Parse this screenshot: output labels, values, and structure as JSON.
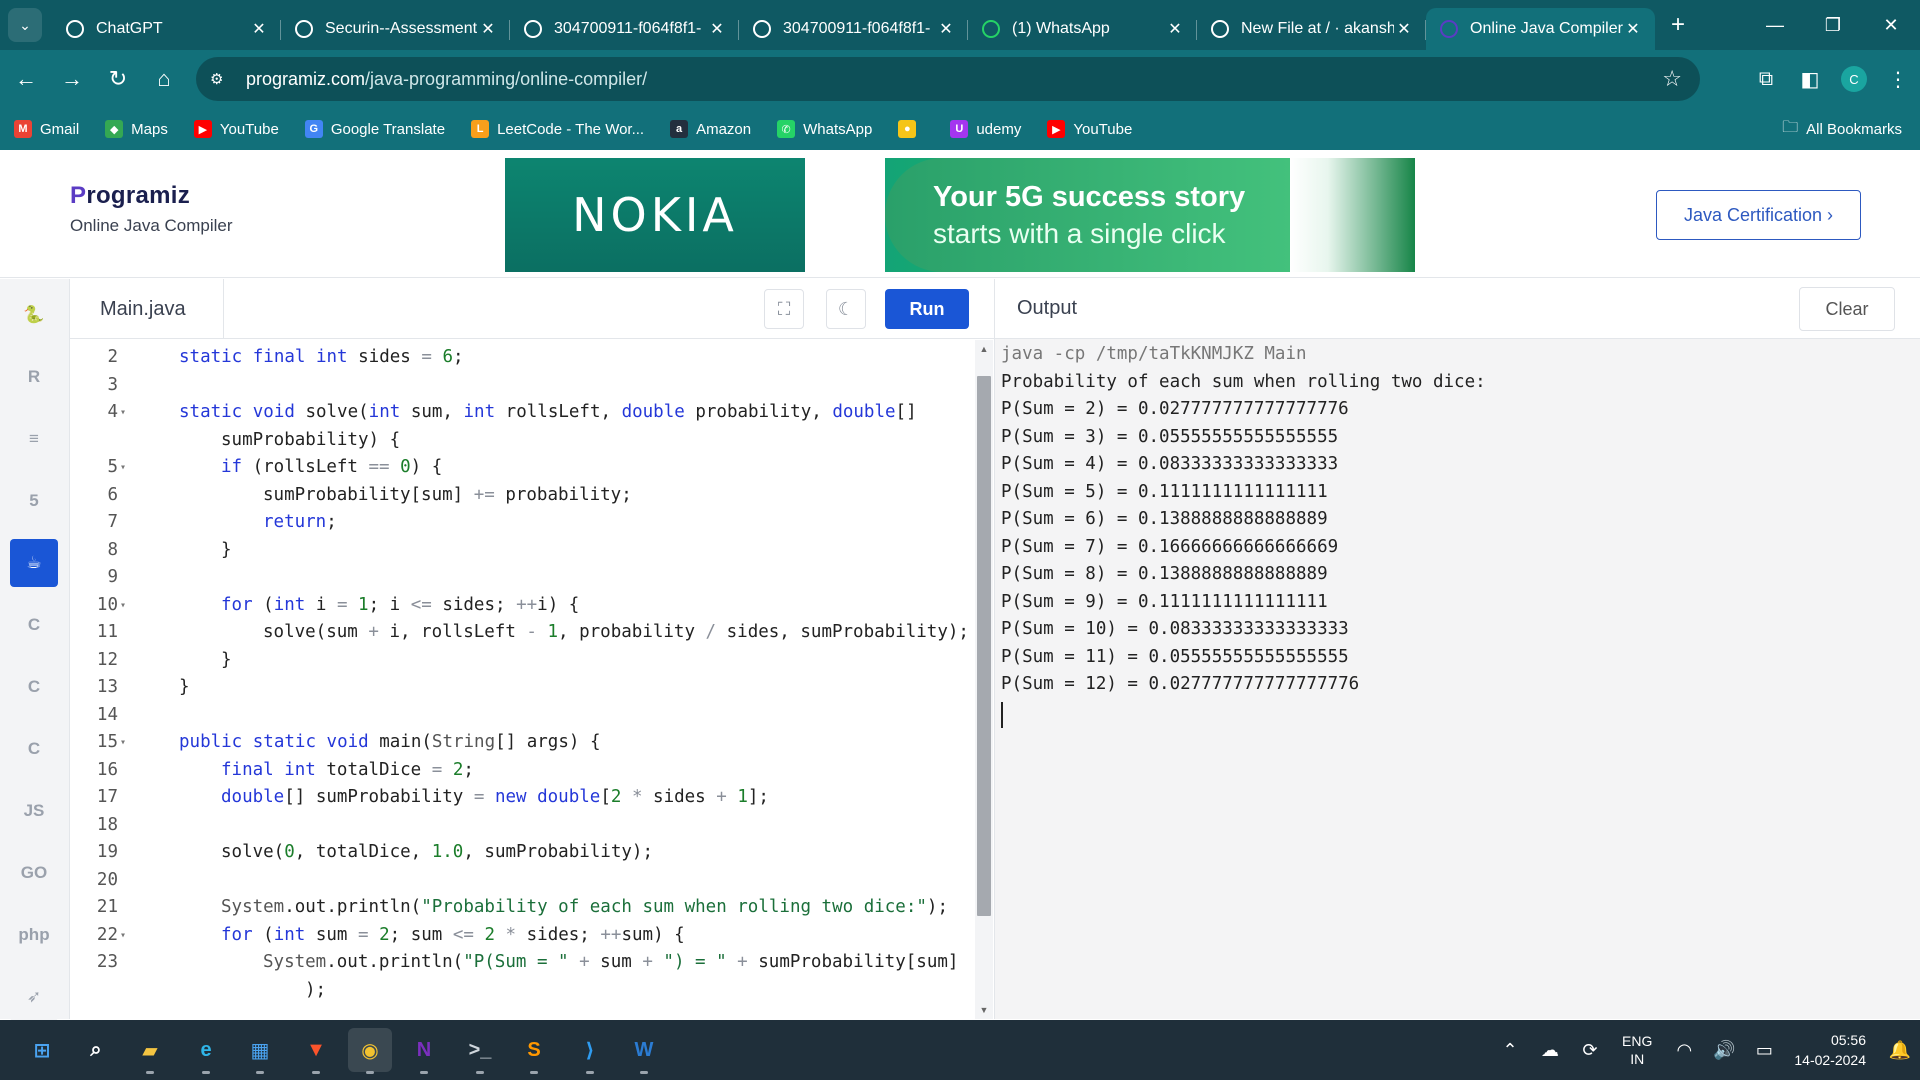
{
  "browser": {
    "tabs": [
      {
        "title": "ChatGPT",
        "icon": "chatgpt-icon",
        "color": "#ffffff"
      },
      {
        "title": "Securin--Assessment",
        "icon": "github-icon",
        "color": "#ffffff"
      },
      {
        "title": "304700911-f064f8f1-",
        "icon": "globe-icon",
        "color": "#ffffff"
      },
      {
        "title": "304700911-f064f8f1-",
        "icon": "globe-icon",
        "color": "#ffffff"
      },
      {
        "title": "(1) WhatsApp",
        "icon": "whatsapp-icon",
        "color": "#25d366"
      },
      {
        "title": "New File at / · akansh",
        "icon": "github-icon",
        "color": "#ffffff"
      },
      {
        "title": "Online Java Compiler",
        "icon": "programiz-icon",
        "color": "#5b3cc4"
      }
    ],
    "active_tab_index": 6,
    "url_host": "programiz.com",
    "url_path": "/java-programming/online-compiler/",
    "profile_initial": "C",
    "bookmarks": [
      {
        "label": "Gmail",
        "icon": "gmail-icon",
        "color": "#ea4335",
        "glyph": "M"
      },
      {
        "label": "Maps",
        "icon": "maps-icon",
        "color": "#34a853",
        "glyph": "◆"
      },
      {
        "label": "YouTube",
        "icon": "youtube-icon",
        "color": "#ff0000",
        "glyph": "▶"
      },
      {
        "label": "Google Translate",
        "icon": "translate-icon",
        "color": "#4285f4",
        "glyph": "G"
      },
      {
        "label": "LeetCode - The Wor...",
        "icon": "leetcode-icon",
        "color": "#f89f1b",
        "glyph": "L"
      },
      {
        "label": "Amazon",
        "icon": "amazon-icon",
        "color": "#232f3e",
        "glyph": "a"
      },
      {
        "label": "WhatsApp",
        "icon": "whatsapp-icon",
        "color": "#25d366",
        "glyph": "✆"
      },
      {
        "label": "",
        "icon": "extension-bee-icon",
        "color": "#f5c518",
        "glyph": "●"
      },
      {
        "label": "udemy",
        "icon": "udemy-icon",
        "color": "#a435f0",
        "glyph": "U"
      },
      {
        "label": "YouTube",
        "icon": "youtube-icon",
        "color": "#ff0000",
        "glyph": "▶"
      }
    ],
    "all_bookmarks_label": "All Bookmarks"
  },
  "header": {
    "logo_text": "rogramiz",
    "logo_initial": "P",
    "subtitle": "Online Java Compiler",
    "ad_brand": "NOKIA",
    "ad_line1": "Your 5G success story",
    "ad_line2": "starts with a single click",
    "cert_button_label": "Java Certification ›"
  },
  "languages": [
    {
      "name": "python",
      "glyph": "🐍"
    },
    {
      "name": "r",
      "glyph": "R"
    },
    {
      "name": "sql",
      "glyph": "≡"
    },
    {
      "name": "html",
      "glyph": "5"
    },
    {
      "name": "java",
      "glyph": "☕",
      "active": true
    },
    {
      "name": "c",
      "glyph": "C"
    },
    {
      "name": "cpp",
      "glyph": "C"
    },
    {
      "name": "csharp",
      "glyph": "C"
    },
    {
      "name": "js",
      "glyph": "JS"
    },
    {
      "name": "go",
      "glyph": "GO"
    },
    {
      "name": "php",
      "glyph": "php"
    },
    {
      "name": "swift",
      "glyph": "➶"
    }
  ],
  "editor": {
    "file_name": "Main.java",
    "run_label": "Run",
    "lines": [
      {
        "n": "2",
        "fold": false,
        "indent": 1,
        "tokens": [
          [
            "kw",
            "static "
          ],
          [
            "kw",
            "final "
          ],
          [
            "kw",
            "int "
          ],
          [
            "",
            "sides "
          ],
          [
            "op",
            "= "
          ],
          [
            "num",
            "6"
          ],
          [
            "",
            ";"
          ]
        ]
      },
      {
        "n": "3",
        "fold": false,
        "indent": 0,
        "tokens": []
      },
      {
        "n": "4",
        "fold": true,
        "indent": 1,
        "tokens": [
          [
            "kw",
            "static "
          ],
          [
            "kw",
            "void "
          ],
          [
            "",
            "solve("
          ],
          [
            "kw",
            "int "
          ],
          [
            "",
            "sum, "
          ],
          [
            "kw",
            "int "
          ],
          [
            "",
            "rollsLeft, "
          ],
          [
            "kw",
            "double "
          ],
          [
            "",
            "probability, "
          ],
          [
            "kw",
            "double"
          ],
          [
            "",
            "[]"
          ]
        ]
      },
      {
        "n": "",
        "fold": false,
        "indent": 2,
        "tokens": [
          [
            "",
            "sumProbability) {"
          ]
        ]
      },
      {
        "n": "5",
        "fold": true,
        "indent": 2,
        "tokens": [
          [
            "kw",
            "if "
          ],
          [
            "",
            "(rollsLeft "
          ],
          [
            "op",
            "== "
          ],
          [
            "num",
            "0"
          ],
          [
            "",
            ") {"
          ]
        ]
      },
      {
        "n": "6",
        "fold": false,
        "indent": 3,
        "tokens": [
          [
            "",
            "sumProbability[sum] "
          ],
          [
            "op",
            "+= "
          ],
          [
            "",
            "probability;"
          ]
        ]
      },
      {
        "n": "7",
        "fold": false,
        "indent": 3,
        "tokens": [
          [
            "kw",
            "return"
          ],
          [
            "",
            ";"
          ]
        ]
      },
      {
        "n": "8",
        "fold": false,
        "indent": 2,
        "tokens": [
          [
            "",
            "}"
          ]
        ]
      },
      {
        "n": "9",
        "fold": false,
        "indent": 0,
        "tokens": []
      },
      {
        "n": "10",
        "fold": true,
        "indent": 2,
        "tokens": [
          [
            "kw",
            "for "
          ],
          [
            "",
            "("
          ],
          [
            "kw",
            "int "
          ],
          [
            "",
            "i "
          ],
          [
            "op",
            "= "
          ],
          [
            "num",
            "1"
          ],
          [
            "",
            "; i "
          ],
          [
            "op",
            "<= "
          ],
          [
            "",
            "sides; "
          ],
          [
            "op",
            "++"
          ],
          [
            "",
            "i) {"
          ]
        ]
      },
      {
        "n": "11",
        "fold": false,
        "indent": 3,
        "tokens": [
          [
            "",
            "solve(sum "
          ],
          [
            "op",
            "+ "
          ],
          [
            "",
            "i, rollsLeft "
          ],
          [
            "op",
            "- "
          ],
          [
            "num",
            "1"
          ],
          [
            "",
            ", probability "
          ],
          [
            "op",
            "/ "
          ],
          [
            "",
            "sides, sumProbability);"
          ]
        ]
      },
      {
        "n": "12",
        "fold": false,
        "indent": 2,
        "tokens": [
          [
            "",
            "}"
          ]
        ]
      },
      {
        "n": "13",
        "fold": false,
        "indent": 1,
        "tokens": [
          [
            "",
            "}"
          ]
        ]
      },
      {
        "n": "14",
        "fold": false,
        "indent": 0,
        "tokens": []
      },
      {
        "n": "15",
        "fold": true,
        "indent": 1,
        "tokens": [
          [
            "kw",
            "public "
          ],
          [
            "kw",
            "static "
          ],
          [
            "kw",
            "void "
          ],
          [
            "",
            "main("
          ],
          [
            "cls",
            "String"
          ],
          [
            "",
            "[] args) {"
          ]
        ]
      },
      {
        "n": "16",
        "fold": false,
        "indent": 2,
        "tokens": [
          [
            "kw",
            "final "
          ],
          [
            "kw",
            "int "
          ],
          [
            "",
            "totalDice "
          ],
          [
            "op",
            "= "
          ],
          [
            "num",
            "2"
          ],
          [
            "",
            ";"
          ]
        ]
      },
      {
        "n": "17",
        "fold": false,
        "indent": 2,
        "tokens": [
          [
            "kw",
            "double"
          ],
          [
            "",
            "[] sumProbability "
          ],
          [
            "op",
            "= "
          ],
          [
            "kw",
            "new "
          ],
          [
            "kw",
            "double"
          ],
          [
            "",
            "["
          ],
          [
            "num",
            "2 "
          ],
          [
            "op",
            "* "
          ],
          [
            "",
            "sides "
          ],
          [
            "op",
            "+ "
          ],
          [
            "num",
            "1"
          ],
          [
            "",
            "];"
          ]
        ]
      },
      {
        "n": "18",
        "fold": false,
        "indent": 0,
        "tokens": []
      },
      {
        "n": "19",
        "fold": false,
        "indent": 2,
        "tokens": [
          [
            "",
            "solve("
          ],
          [
            "num",
            "0"
          ],
          [
            "",
            ", totalDice, "
          ],
          [
            "num",
            "1.0"
          ],
          [
            "",
            ", sumProbability);"
          ]
        ]
      },
      {
        "n": "20",
        "fold": false,
        "indent": 0,
        "tokens": []
      },
      {
        "n": "21",
        "fold": false,
        "indent": 2,
        "tokens": [
          [
            "cls",
            "System"
          ],
          [
            "",
            ".out.println("
          ],
          [
            "str",
            "\"Probability of each sum when rolling two dice:\""
          ],
          [
            "",
            ");"
          ]
        ]
      },
      {
        "n": "22",
        "fold": true,
        "indent": 2,
        "tokens": [
          [
            "kw",
            "for "
          ],
          [
            "",
            "("
          ],
          [
            "kw",
            "int "
          ],
          [
            "",
            "sum "
          ],
          [
            "op",
            "= "
          ],
          [
            "num",
            "2"
          ],
          [
            "",
            "; sum "
          ],
          [
            "op",
            "<= "
          ],
          [
            "num",
            "2 "
          ],
          [
            "op",
            "* "
          ],
          [
            "",
            "sides; "
          ],
          [
            "op",
            "++"
          ],
          [
            "",
            "sum) {"
          ]
        ]
      },
      {
        "n": "23",
        "fold": false,
        "indent": 3,
        "tokens": [
          [
            "cls",
            "System"
          ],
          [
            "",
            ".out.println("
          ],
          [
            "str",
            "\"P(Sum = \" "
          ],
          [
            "op",
            "+ "
          ],
          [
            "",
            "sum "
          ],
          [
            "op",
            "+ "
          ],
          [
            "str",
            "\") = \" "
          ],
          [
            "op",
            "+ "
          ],
          [
            "",
            "sumProbability[sum]"
          ]
        ]
      },
      {
        "n": "",
        "fold": false,
        "indent": 4,
        "tokens": [
          [
            "",
            ");"
          ]
        ]
      }
    ]
  },
  "output": {
    "title": "Output",
    "clear_label": "Clear",
    "command": "java -cp /tmp/taTkKNMJKZ Main",
    "lines": [
      "Probability of each sum when rolling two dice:",
      "P(Sum = 2) = 0.027777777777777776",
      "P(Sum = 3) = 0.05555555555555555",
      "P(Sum = 4) = 0.08333333333333333",
      "P(Sum = 5) = 0.1111111111111111",
      "P(Sum = 6) = 0.1388888888888889",
      "P(Sum = 7) = 0.16666666666666669",
      "P(Sum = 8) = 0.1388888888888889",
      "P(Sum = 9) = 0.1111111111111111",
      "P(Sum = 10) = 0.08333333333333333",
      "P(Sum = 11) = 0.05555555555555555",
      "P(Sum = 12) = 0.027777777777777776"
    ]
  },
  "taskbar": {
    "apps": [
      {
        "name": "start",
        "glyph": "⊞",
        "color": "#4aa3f0"
      },
      {
        "name": "search",
        "glyph": "⌕",
        "color": "#ffffff"
      },
      {
        "name": "file-explorer",
        "glyph": "▰",
        "color": "#f4c542"
      },
      {
        "name": "edge",
        "glyph": "e",
        "color": "#2fb5e8"
      },
      {
        "name": "store",
        "glyph": "▦",
        "color": "#4aa3f0"
      },
      {
        "name": "brave",
        "glyph": "▼",
        "color": "#fb542b"
      },
      {
        "name": "chrome",
        "glyph": "◉",
        "color": "#f2c230",
        "active": true
      },
      {
        "name": "onenote",
        "glyph": "N",
        "color": "#7b2fbe"
      },
      {
        "name": "terminal",
        "glyph": ">_",
        "color": "#cfd6dc"
      },
      {
        "name": "sublime",
        "glyph": "S",
        "color": "#ff9800"
      },
      {
        "name": "vscode",
        "glyph": "⟩",
        "color": "#2f9cf0"
      },
      {
        "name": "word",
        "glyph": "W",
        "color": "#2b7cd3"
      }
    ],
    "lang_top": "ENG",
    "lang_bottom": "IN",
    "time": "05:56",
    "date": "14-02-2024"
  }
}
